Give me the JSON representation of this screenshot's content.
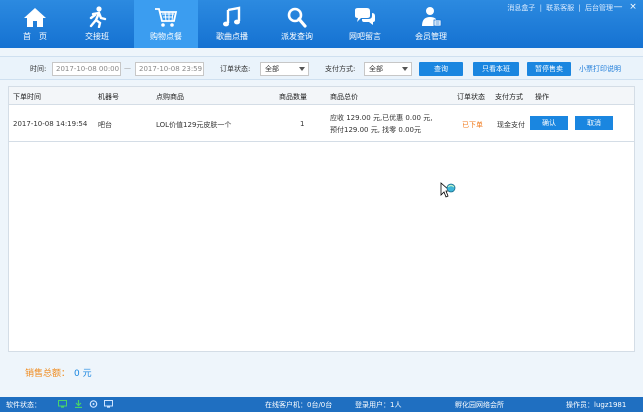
{
  "nav": {
    "items": [
      {
        "key": "home",
        "label": "首　页",
        "icon": "home-icon"
      },
      {
        "key": "shift",
        "label": "交接班",
        "icon": "runner-icon"
      },
      {
        "key": "shop",
        "label": "购物点餐",
        "icon": "cart-icon",
        "active": true
      },
      {
        "key": "music",
        "label": "歌曲点播",
        "icon": "music-icon"
      },
      {
        "key": "dispatch",
        "label": "派发查询",
        "icon": "search-icon"
      },
      {
        "key": "message",
        "label": "网吧留言",
        "icon": "chat-icon"
      },
      {
        "key": "member",
        "label": "会员管理",
        "icon": "member-icon"
      }
    ],
    "links": [
      "消息盒子",
      "联系客服",
      "后台管理"
    ],
    "window_controls": [
      "—",
      "×"
    ]
  },
  "filters": {
    "time_label": "时间:",
    "start_time": "2017-10-08 00:00",
    "separator": "—",
    "end_time": "2017-10-08 23:59",
    "order_status_label": "订单状态:",
    "order_status_value": "全部",
    "pay_method_label": "支付方式:",
    "pay_method_value": "全部",
    "query_btn": "查询",
    "view_shift_btn": "只看本班",
    "pause_sale_btn": "暂停售卖",
    "print_receipt_link": "小票打印说明"
  },
  "table": {
    "headers": [
      "下单时间",
      "机器号",
      "点购商品",
      "商品数量",
      "商品总价",
      "订单状态",
      "支付方式",
      "操作"
    ],
    "rows": [
      {
        "time": "2017-10-08 14:19:54",
        "machine": "吧台",
        "product": "LOL价值129元皮肤一个",
        "qty": "1",
        "price_line1": "应收 129.00 元,已优惠 0.00 元,",
        "price_line2": "预付129.00 元, 找零 0.00元",
        "status": "已下单",
        "pay": "现金支付",
        "confirm_btn": "确认",
        "cancel_btn": "取消"
      }
    ]
  },
  "summary": {
    "label": "销售总额：",
    "value": "0 元"
  },
  "statusbar": {
    "software_status": "软件状态：",
    "online": "在线客户机：0台/0台",
    "logged_in": "登录用户：1人",
    "venue": "孵化园网络会所",
    "operator": "操作员：lugz1981"
  },
  "colors": {
    "nav_bg": "#1a7ad9",
    "nav_active": "#3b9df0",
    "button": "#1a86e0",
    "status_orange": "#f07a1c",
    "statusbar": "#1f6fc1"
  }
}
